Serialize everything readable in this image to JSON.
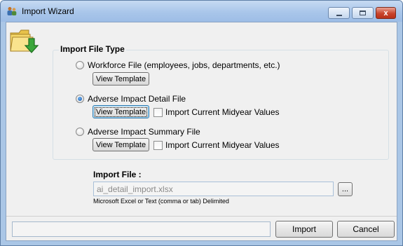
{
  "window": {
    "title": "Import Wizard"
  },
  "titlebar": {
    "close_glyph": "x"
  },
  "icons": {
    "app_icon": "people-icon",
    "wizard_icon": "folder-download-icon"
  },
  "import_type": {
    "group_title": "Import File Type",
    "options": [
      {
        "label": "Workforce File (employees, jobs, departments, etc.)",
        "checked": false,
        "button_label": "View Template"
      },
      {
        "label": "Adverse Impact Detail File",
        "checked": true,
        "button_label": "View Template",
        "checkbox_label": "Import Current Midyear Values",
        "checkbox_checked": false
      },
      {
        "label": "Adverse Impact Summary File",
        "checked": false,
        "button_label": "View Template",
        "checkbox_label": "Import Current Midyear Values",
        "checkbox_checked": false
      }
    ]
  },
  "import_file": {
    "label": "Import File :",
    "value": "ai_detail_import.xlsx",
    "browse_label": "...",
    "hint": "Microsoft Excel or Text (comma or tab) Delimited"
  },
  "footer": {
    "status_text": "",
    "import_label": "Import",
    "cancel_label": "Cancel"
  },
  "colors": {
    "titlebar": "#a9c6ea",
    "client_bg": "#f0f0f0",
    "close_button": "#c8442d"
  }
}
